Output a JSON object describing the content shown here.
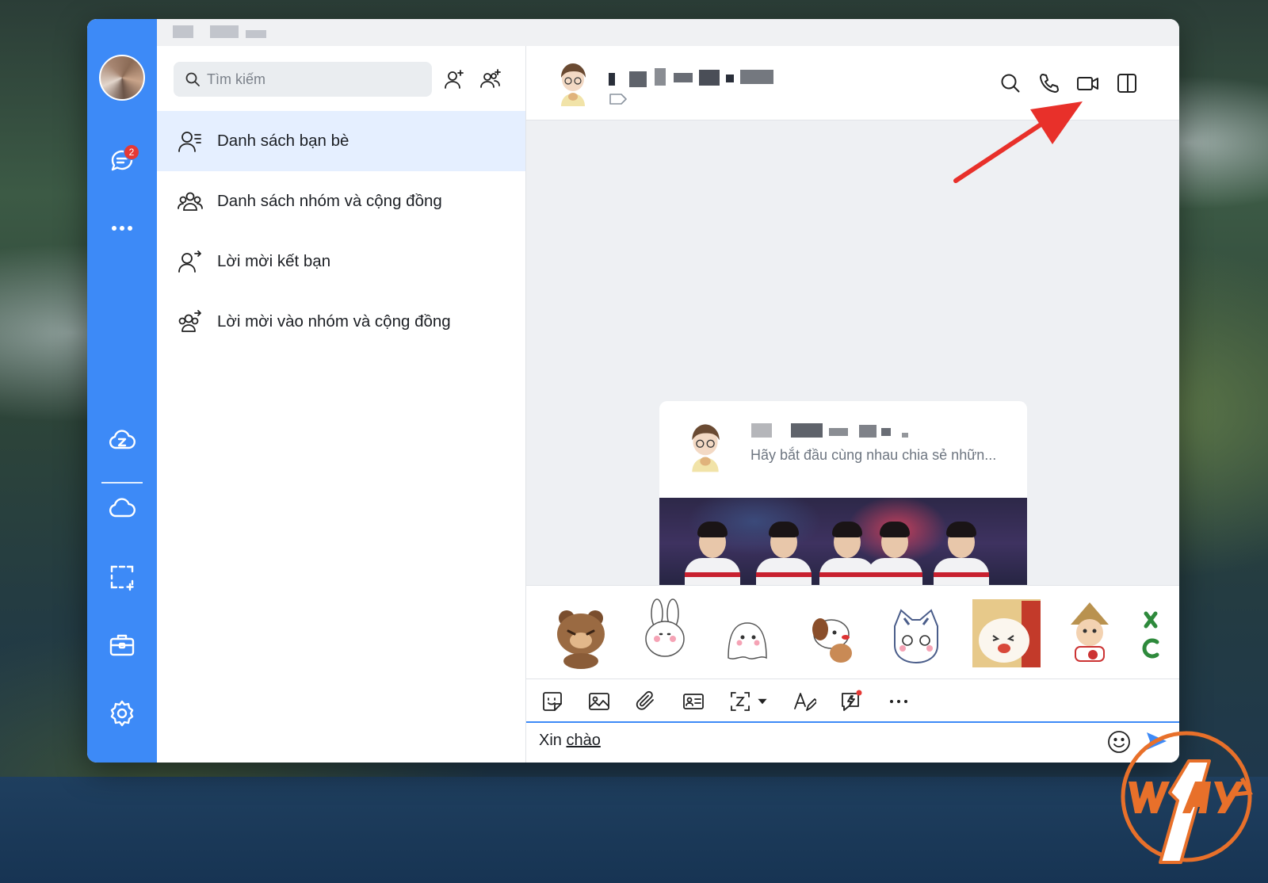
{
  "titlebar": {
    "title": ""
  },
  "rail": {
    "badge_count": "2",
    "items": [
      "avatar",
      "messages",
      "more",
      "zcloud",
      "cloud",
      "screenshot",
      "toolbox",
      "settings"
    ]
  },
  "contacts": {
    "search": {
      "placeholder": "Tìm kiếm",
      "value": ""
    },
    "menu": [
      {
        "label": "Danh sách bạn bè",
        "icon": "friend-list-icon",
        "active": true
      },
      {
        "label": "Danh sách nhóm và cộng đồng",
        "icon": "group-list-icon",
        "active": false
      },
      {
        "label": "Lời mời kết bạn",
        "icon": "friend-request-icon",
        "active": false
      },
      {
        "label": "Lời mời vào nhóm và cộng đồng",
        "icon": "group-invite-icon",
        "active": false
      }
    ]
  },
  "chat": {
    "card": {
      "description": "Hãy bắt đầu cùng nhau chia sẻ nhữn..."
    },
    "composer": {
      "text_prefix": "Xin ",
      "text_underlined": "chào"
    }
  },
  "colors": {
    "accent": "#3d8af7",
    "active_bg": "#e5efff",
    "arrow": "#e8302a",
    "watermark": "#e8702a",
    "badge": "#e53935"
  }
}
